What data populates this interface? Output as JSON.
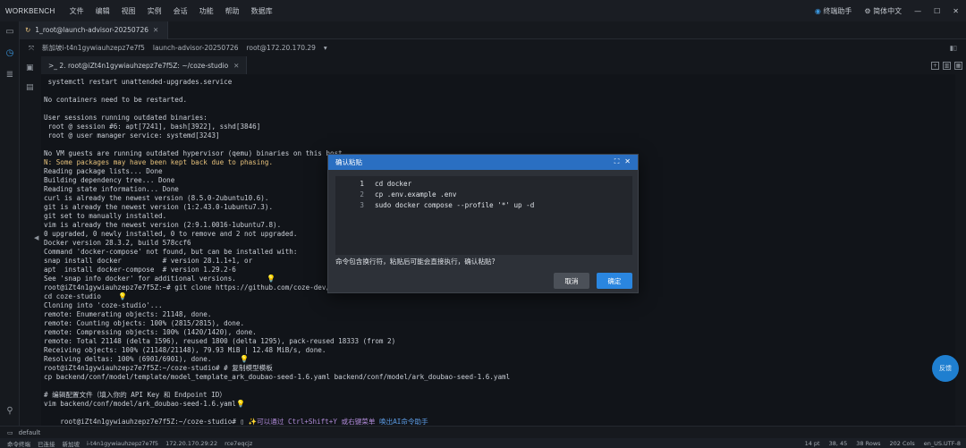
{
  "menubar": {
    "app_name": "WORKBENCH",
    "items": [
      "文件",
      "编辑",
      "视图",
      "实例",
      "会话",
      "功能",
      "帮助",
      "数据库"
    ],
    "assistant": "终端助手",
    "theme": "简体中文"
  },
  "tabs": [
    {
      "label": "1_root@launch-advisor-20250726"
    }
  ],
  "session": {
    "instance": "新加坡i-t4n1gywiauhzepz7e7f5",
    "name": "launch-advisor-20250726",
    "host": "root@172.20.170.29"
  },
  "terminal_tab": {
    "label": ">_ 2. root@iZt4n1gywiauhzepz7e7f5Z: ~/coze-studio"
  },
  "terminal_lines": [
    " systemctl restart unattended-upgrades.service",
    "",
    "No containers need to be restarted.",
    "",
    "User sessions running outdated binaries:",
    " root @ session #6: apt[7241], bash[3922], sshd[3846]",
    " root @ user manager service: systemd[3243]",
    "",
    "No VM guests are running outdated hypervisor (qemu) binaries on this host.",
    "N: Some packages may have been kept back due to phasing.",
    "Reading package lists... Done",
    "Building dependency tree... Done",
    "Reading state information... Done",
    "curl is already the newest version (8.5.0-2ubuntu10.6).",
    "git is already the newest version (1:2.43.0-1ubuntu7.3).",
    "git set to manually installed.",
    "vim is already the newest version (2:9.1.0016-1ubuntu7.8).",
    "0 upgraded, 0 newly installed, 0 to remove and 2 not upgraded.",
    "Docker version 28.3.2, build 578ccf6",
    "Command 'docker-compose' not found, but can be installed with:",
    "snap install docker          # version 28.1.1+1, or",
    "apt  install docker-compose  # version 1.29.2-6",
    "See 'snap info docker' for additional versions.",
    "root@iZt4n1gywiauhzepz7e7f5Z:~# git clone https://github.com/coze-dev/coze-studio",
    "cd coze-studio",
    "Cloning into 'coze-studio'...",
    "remote: Enumerating objects: 21148, done.",
    "remote: Counting objects: 100% (2815/2815), done.",
    "remote: Compressing objects: 100% (1420/1420), done.",
    "remote: Total 21148 (delta 1596), reused 1800 (delta 1295), pack-reused 18333 (from 2)",
    "Receiving objects: 100% (21148/21148), 79.93 MiB | 12.48 MiB/s, done.",
    "Resolving deltas: 100% (6901/6901), done.",
    "root@iZt4n1gywiauhzepz7e7f5Z:~/coze-studio# # 复制模型模板",
    "cp backend/conf/model/template/model_template_ark_doubao-seed-1.6.yaml backend/conf/model/ark_doubao-seed-1.6.yaml",
    "",
    "# 编辑配置文件（填入你的 API Key 和 Endpoint ID）",
    "vim backend/conf/model/ark_doubao-seed-1.6.yaml",
    "root@iZt4n1gywiauhzepz7e7f5Z:~/coze-studio# "
  ],
  "prompt_hint": {
    "hint_text": "可以通过 Ctrl+Shift+Y 或右键菜单",
    "hint_link": "唤出AI命令助手"
  },
  "dialog": {
    "title": "确认粘贴",
    "lines": [
      {
        "num": "1",
        "text": "cd docker"
      },
      {
        "num": "2",
        "text": "cp .env.example .env"
      },
      {
        "num": "3",
        "text": "sudo docker compose --profile '*' up -d"
      }
    ],
    "message": "命令包含换行符，粘贴后可能会直接执行，确认粘贴?",
    "cancel_label": "取消",
    "confirm_label": "确定"
  },
  "bubble_label": "反馈",
  "bottombar": {
    "label": "default"
  },
  "statusbar": {
    "left": [
      "命令终端",
      "已连接",
      "新加坡",
      "i-t4n1gywiauhzepz7e7f5",
      "172.20.170.29:22",
      "rce7eqcjz"
    ],
    "font": "14 pt",
    "cursor": "38, 45",
    "rows": "38 Rows",
    "cols": "202 Cols",
    "encoding": "en_US.UTF-8"
  }
}
